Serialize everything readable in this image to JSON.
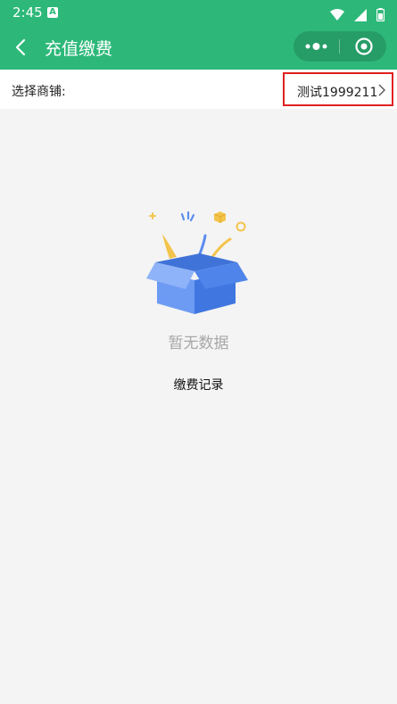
{
  "status_bar": {
    "time": "2:45",
    "notification_letter": "A"
  },
  "nav": {
    "title": "充值缴费"
  },
  "shop": {
    "label": "选择商铺:",
    "value": "测试1999211"
  },
  "empty": {
    "text": "暂无数据"
  },
  "record": {
    "label": "缴费记录"
  },
  "colors": {
    "brand": "#2db879",
    "highlight": "#e02020",
    "empty_text": "#a7a7a7"
  },
  "icons": [
    "back-icon",
    "more-dots-icon",
    "close-circle-icon",
    "chevron-right-icon",
    "wifi-icon",
    "signal-icon",
    "battery-icon"
  ]
}
